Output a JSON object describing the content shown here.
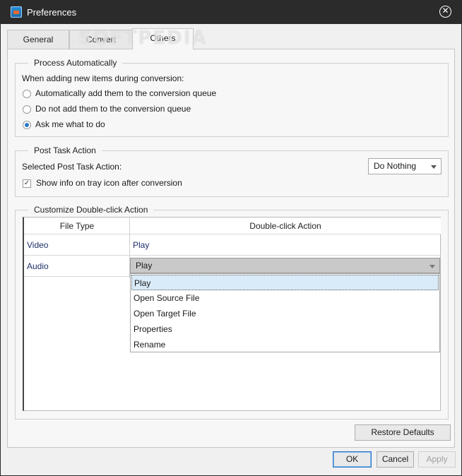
{
  "window": {
    "title": "Preferences"
  },
  "watermark": "SOFTPEDIA",
  "tabs": [
    {
      "label": "General",
      "active": false
    },
    {
      "label": "Convert",
      "active": false
    },
    {
      "label": "Others",
      "active": true
    }
  ],
  "process": {
    "legend": "Process Automatically",
    "prompt": "When adding new items during conversion:",
    "options": [
      {
        "label": "Automatically add them to the conversion queue",
        "checked": false
      },
      {
        "label": "Do not add them to the conversion queue",
        "checked": false
      },
      {
        "label": "Ask me what to do",
        "checked": true
      }
    ]
  },
  "post_task": {
    "legend": "Post Task Action",
    "label": "Selected Post Task Action:",
    "selected": "Do Nothing",
    "show_info_label": "Show info on tray icon after conversion",
    "show_info_checked": true
  },
  "double_click": {
    "legend": "Customize Double-click Action",
    "headers": {
      "file_type": "File Type",
      "action": "Double-click Action"
    },
    "rows": [
      {
        "type": "Video",
        "action": "Play"
      },
      {
        "type": "Audio",
        "action": "Play"
      }
    ],
    "dropdown_options": [
      "Play",
      "Open Source File",
      "Open Target File",
      "Properties",
      "Rename"
    ],
    "dropdown_selected": "Play"
  },
  "buttons": {
    "restore_defaults": "Restore Defaults",
    "ok": "OK",
    "cancel": "Cancel",
    "apply": "Apply"
  }
}
